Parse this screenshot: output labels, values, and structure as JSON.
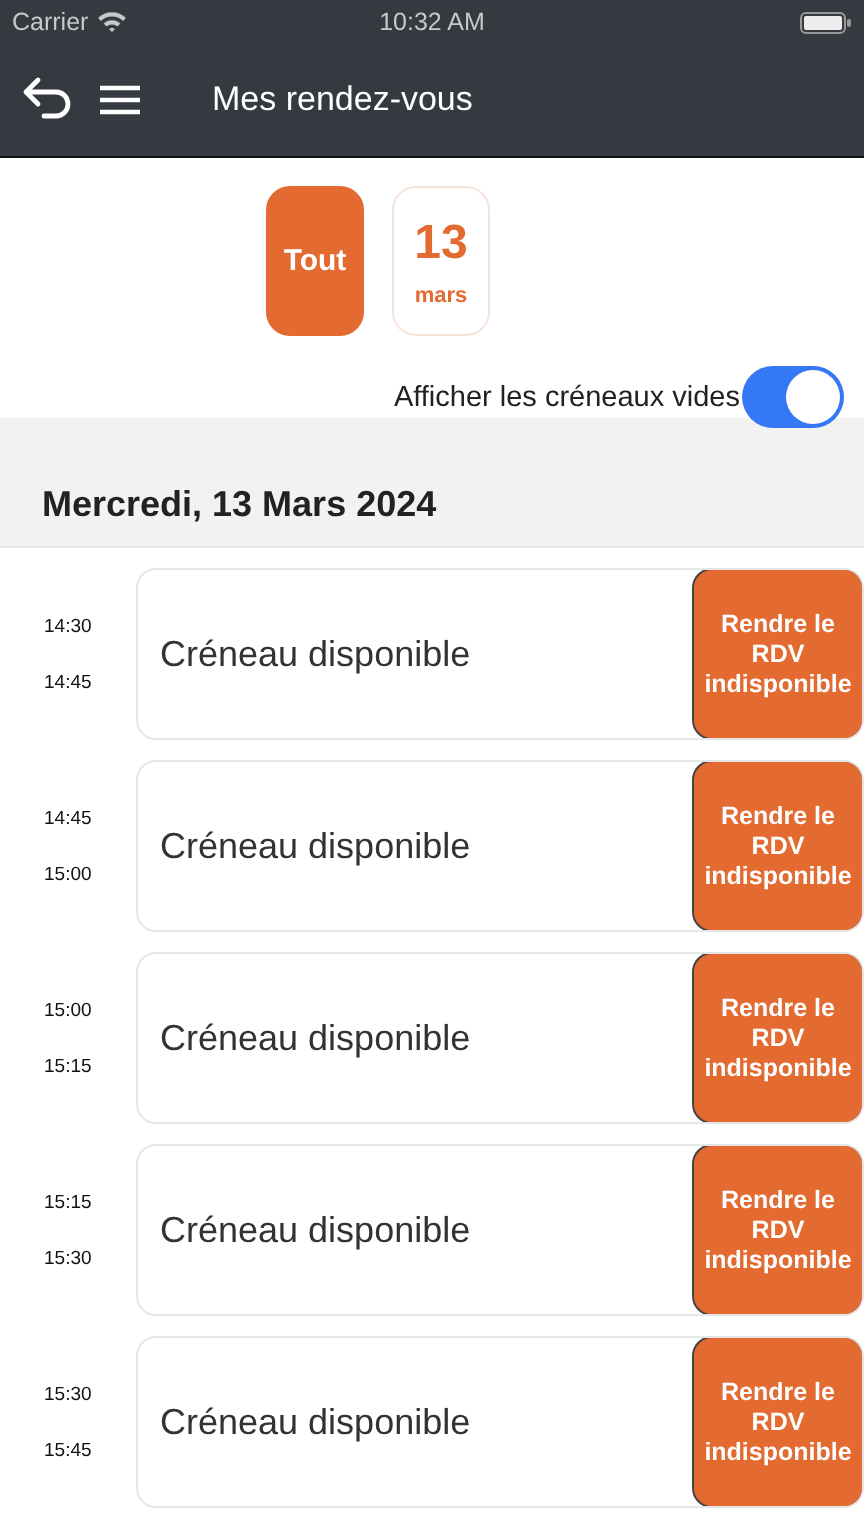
{
  "status_bar": {
    "carrier": "Carrier",
    "time": "10:32 AM"
  },
  "header": {
    "title": "Mes rendez-vous"
  },
  "date_filters": [
    {
      "kind": "label",
      "label": "Tout",
      "selected": true
    },
    {
      "kind": "date",
      "day": "13",
      "month": "mars",
      "selected": false
    }
  ],
  "empty_slots_toggle": {
    "label": "Afficher les créneaux vides",
    "on": true
  },
  "day_heading": "Mercredi, 13 Mars 2024",
  "slots": [
    {
      "start": "14:30",
      "end": "14:45",
      "label": "Créneau disponible",
      "action": "Rendre le RDV indisponible"
    },
    {
      "start": "14:45",
      "end": "15:00",
      "label": "Créneau disponible",
      "action": "Rendre le RDV indisponible"
    },
    {
      "start": "15:00",
      "end": "15:15",
      "label": "Créneau disponible",
      "action": "Rendre le RDV indisponible"
    },
    {
      "start": "15:15",
      "end": "15:30",
      "label": "Créneau disponible",
      "action": "Rendre le RDV indisponible"
    },
    {
      "start": "15:30",
      "end": "15:45",
      "label": "Créneau disponible",
      "action": "Rendre le RDV indisponible"
    }
  ]
}
